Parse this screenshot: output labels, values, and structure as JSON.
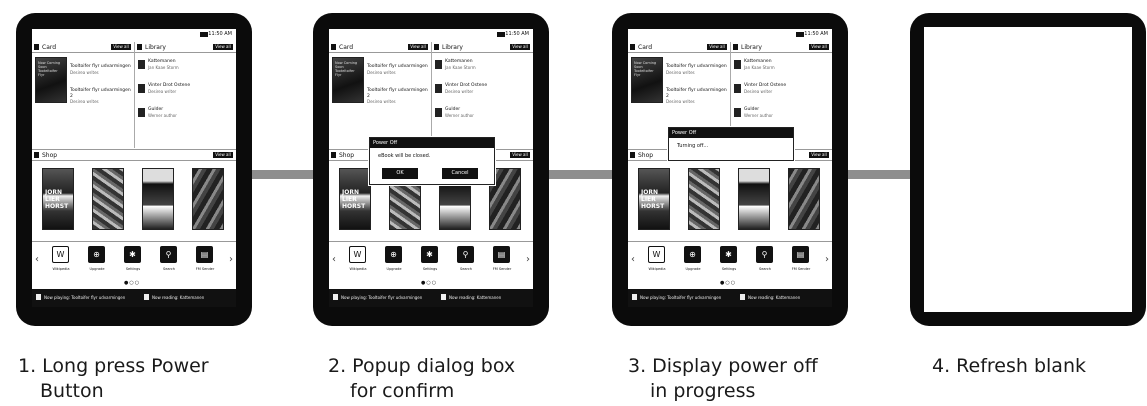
{
  "captions": [
    {
      "line1": "1. Long press Power",
      "line2": "Button"
    },
    {
      "line1": "2. Popup dialog box",
      "line2": "for confirm"
    },
    {
      "line1": "3. Display power off",
      "line2": "in progress"
    },
    {
      "line1": "4. Refresh blank",
      "line2": ""
    }
  ],
  "screen": {
    "time": "11:50 AM",
    "card_title": "Card",
    "library_title": "Library",
    "shop_title": "Shop",
    "view_all": "View all",
    "cover_text": "Now Coming Soon Tooteltoifer Flyr",
    "card_entries": [
      {
        "title": "Tooltoifer flyr udvarmingen",
        "sub": "Desirea writes"
      },
      {
        "title": "Tooltoifer flyr udvarmingen 2",
        "sub": "Desirea writes"
      }
    ],
    "library_items": [
      {
        "title": "Kattemanen",
        "sub": "Jan Kaae Storm"
      },
      {
        "title": "Vinter Drot Ostene",
        "sub": "Desirea writer"
      },
      {
        "title": "Gulder",
        "sub": "Werner author"
      }
    ],
    "book_text": "JORN LIER HORST",
    "apps": [
      {
        "icon": "W",
        "label": "Wikipedia"
      },
      {
        "icon": "⊕",
        "label": "Upgrade"
      },
      {
        "icon": "✱",
        "label": "Settings"
      },
      {
        "icon": "⚲",
        "label": "Search"
      },
      {
        "icon": "▤",
        "label": "FM Sender"
      }
    ],
    "page_dots": "●○○",
    "now_playing": "Now playing: Tooltoifer flyr udvarmingen",
    "now_reading": "Now reading: Kattemanen"
  },
  "dialog_confirm": {
    "title": "Power Off",
    "message": "eBook will be closed.",
    "ok": "OK",
    "cancel": "Cancel"
  },
  "dialog_progress": {
    "title": "Power Off",
    "message": "Turning off..."
  }
}
